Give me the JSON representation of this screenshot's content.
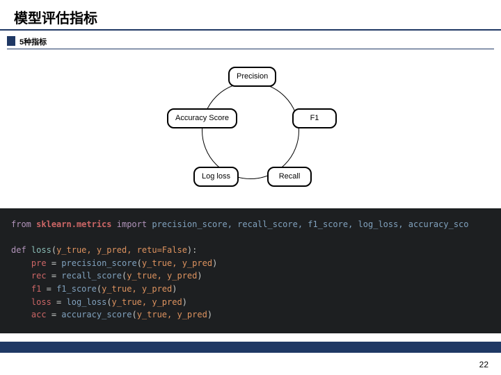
{
  "title": "模型评估指标",
  "subtitle": "5种指标",
  "diagram": {
    "nodes": {
      "top": "Precision",
      "left": "Accuracy\nScore",
      "right": "F1",
      "bottom_left": "Log loss",
      "bottom_right": "Recall"
    }
  },
  "code": {
    "line1": {
      "kw1": "from",
      "mod": "sklearn.metrics",
      "kw2": "import",
      "imports": "precision_score, recall_score, f1_score, log_loss, accuracy_sco"
    },
    "def": {
      "kw": "def",
      "name": "loss",
      "args": "y_true, y_pred, retu",
      "eq": "=",
      "false": "False"
    },
    "body": [
      {
        "lhs": "pre",
        "fn": "precision_score",
        "args": "y_true, y_pred"
      },
      {
        "lhs": "rec",
        "fn": "recall_score",
        "args": "y_true, y_pred"
      },
      {
        "lhs": "f1",
        "fn": "f1_score",
        "args": "y_true, y_pred"
      },
      {
        "lhs": "loss",
        "fn": "log_loss",
        "args": "y_true, y_pred"
      },
      {
        "lhs": "acc",
        "fn": "accuracy_score",
        "args": "y_true, y_pred"
      }
    ]
  },
  "page_number": "22"
}
